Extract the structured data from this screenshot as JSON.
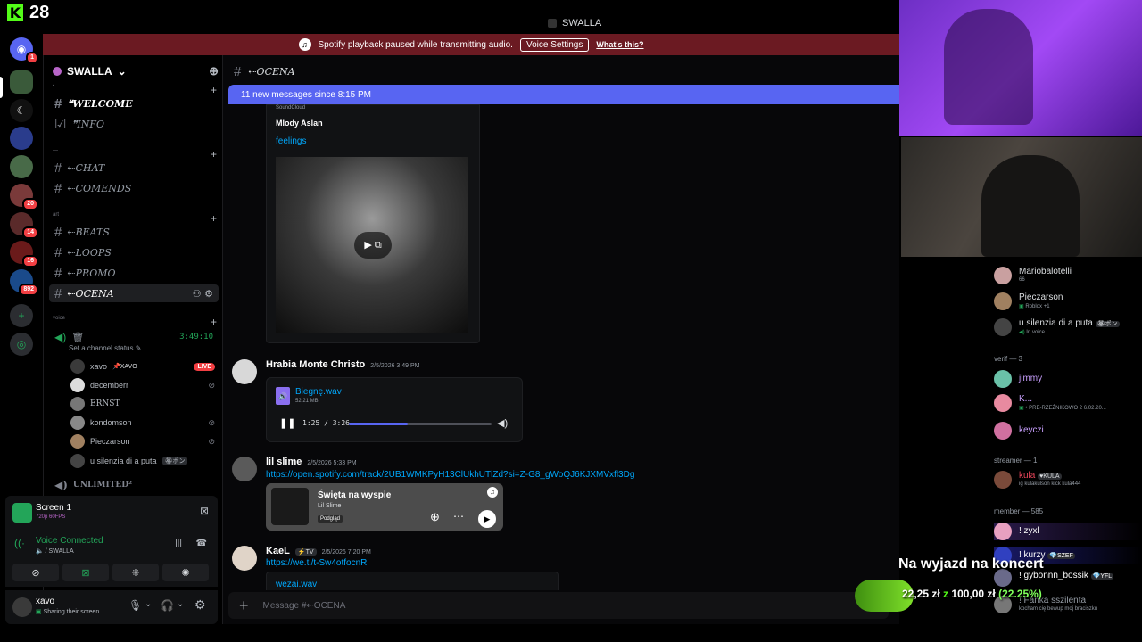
{
  "stream": {
    "viewer_count": "28"
  },
  "window": {
    "title": "SWALLA"
  },
  "banner": {
    "text": "Spotify playback paused while transmitting audio.",
    "voice_settings": "Voice Settings",
    "whats_this": "What's this?"
  },
  "rail": {
    "servers": [
      {
        "icon": "discord-icon",
        "badge": "1"
      },
      {
        "icon": "server-icon",
        "badge": ""
      },
      {
        "icon": "server-icon",
        "badge": ""
      },
      {
        "icon": "server-icon",
        "badge": ""
      },
      {
        "icon": "server-icon",
        "badge": ""
      },
      {
        "icon": "server-icon",
        "badge": "20"
      },
      {
        "icon": "server-icon",
        "badge": "14"
      },
      {
        "icon": "server-icon",
        "badge": "16"
      },
      {
        "icon": "server-icon",
        "badge": "892"
      }
    ]
  },
  "sidebar": {
    "server_name": "SWALLA",
    "channels": [
      {
        "name": "❝WELCOME",
        "style": "bold"
      },
      {
        "name": "❞INFO",
        "style": "normal"
      },
      {
        "name": "⇠CHAT",
        "style": "normal"
      },
      {
        "name": "⇠COMENDS",
        "style": "normal"
      },
      {
        "name": "⇠BEATS",
        "style": "normal"
      },
      {
        "name": "⇠LOOPS",
        "style": "normal"
      },
      {
        "name": "⇠PROMO",
        "style": "normal"
      },
      {
        "name": "⇠OCENA",
        "style": "active"
      }
    ],
    "cat_voice": "voice",
    "voice_channel": {
      "timer": "3:49:10",
      "status": "Set a channel status",
      "users": [
        {
          "name": "xavo",
          "tag": "XAVO",
          "live": "LIVE"
        },
        {
          "name": "decemberr"
        },
        {
          "name": "ERNST"
        },
        {
          "name": "kondomson"
        },
        {
          "name": "Pieczarson"
        },
        {
          "name": "u silenzia di a puta",
          "tag": "ポン"
        }
      ]
    },
    "unlimited": "UNLIMITED²"
  },
  "screen_panel": {
    "title": "Screen 1",
    "quality": "720p 60FPS"
  },
  "voice_panel": {
    "status": "Voice Connected",
    "server": "/ SWALLA"
  },
  "user_panel": {
    "name": "xavo",
    "status": "Sharing their screen"
  },
  "chat": {
    "channel": "⇠OCENA",
    "new_messages": "11 new messages since 8:15 PM",
    "embed1": {
      "provider": "SoundCloud",
      "author": "Mlody Aslan",
      "title": "feelings"
    },
    "msg1": {
      "author": "Hrabia Monte Christo",
      "time": "2/5/2026 3:49 PM",
      "file": "Biegnę.wav",
      "size": "52.21 MB",
      "progress": "1:25 / 3:26",
      "progress_fraction": 0.41
    },
    "msg2": {
      "author": "lil slime",
      "time": "2/5/2026 5:33 PM",
      "link": "https://open.spotify.com/track/2UB1WMKPyH13ClUkhUTlZd?si=Z-G8_gWoQJ6KJXMVxfl3Dg",
      "track": "Święta na wyspie",
      "artist": "Lil Slime",
      "preview": "Podgląd"
    },
    "msg3": {
      "author": "KaeL",
      "tag": "TV",
      "time": "2/5/2026 7:20 PM",
      "link": "https://we.tl/t-Sw4otfocnR",
      "file": "wezai.wav"
    },
    "input_placeholder": "Message #⇠OCENA"
  },
  "members": {
    "top": [
      {
        "name": "Mariobalotelli",
        "sub": "66"
      },
      {
        "name": "Pieczarson",
        "sub": "Roblox +1"
      },
      {
        "name": "u silenzia di a puta",
        "tag": "ポン",
        "sub": "In voice"
      }
    ],
    "verif_header": "verif — 3",
    "verif": [
      {
        "name": "jimmy",
        "sub": ""
      },
      {
        "name": "K...",
        "sub": "• PRE-RZEŹNIKOWO 2 6.02.20..."
      },
      {
        "name": "keyczi",
        "sub": ""
      }
    ],
    "streamer_header": "streamer — 1",
    "streamer": [
      {
        "name": "kula",
        "tag": "KULA",
        "sub": "ig kulakulson kick kula444"
      }
    ],
    "member_header": "member — 585",
    "member": [
      {
        "name": "! zyxl"
      },
      {
        "name": "! kurzy",
        "tag": "SZEF"
      },
      {
        "name": "! gybonnn_bossik",
        "tag": "YFL"
      },
      {
        "name": "! Fanka sszilenta",
        "sub": "kocham cię bewup moj braciszku"
      }
    ]
  },
  "goal": {
    "title": "Na wyjazd na koncert",
    "current": "22,25 zł",
    "z": "z",
    "target": "100,00 zł",
    "percent": "(22.25%)",
    "fraction": 0.2225
  },
  "colors": {
    "blurple": "#5865f2",
    "kick_green": "#53fc18",
    "link": "#00a8fc",
    "banner": "#6b1a22"
  }
}
